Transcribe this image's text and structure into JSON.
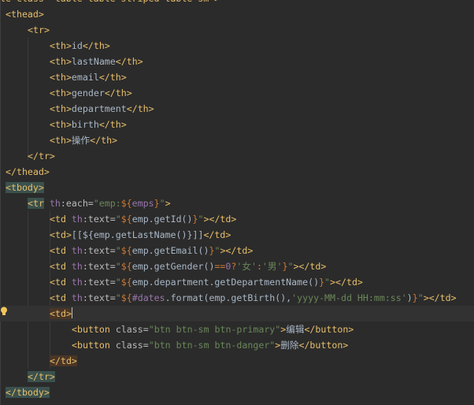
{
  "editor": {
    "language": "html",
    "current_line_index": 19
  },
  "lines": [
    {
      "indent": 0,
      "tokens": [
        {
          "t": "le class=\"table table-striped table-sm\">",
          "c": "tag"
        }
      ],
      "partial_top": true
    },
    {
      "indent": 0,
      "tokens": [
        {
          "t": "<thead>",
          "c": "tag"
        }
      ]
    },
    {
      "indent": 1,
      "tokens": [
        {
          "t": "<tr>",
          "c": "tag"
        }
      ]
    },
    {
      "indent": 2,
      "tokens": [
        {
          "t": "<th>",
          "c": "tag"
        },
        {
          "t": "id",
          "c": "txt"
        },
        {
          "t": "</th>",
          "c": "tag"
        }
      ]
    },
    {
      "indent": 2,
      "tokens": [
        {
          "t": "<th>",
          "c": "tag"
        },
        {
          "t": "lastName",
          "c": "txt"
        },
        {
          "t": "</th>",
          "c": "tag"
        }
      ]
    },
    {
      "indent": 2,
      "tokens": [
        {
          "t": "<th>",
          "c": "tag"
        },
        {
          "t": "email",
          "c": "txt"
        },
        {
          "t": "</th>",
          "c": "tag"
        }
      ]
    },
    {
      "indent": 2,
      "tokens": [
        {
          "t": "<th>",
          "c": "tag"
        },
        {
          "t": "gender",
          "c": "txt"
        },
        {
          "t": "</th>",
          "c": "tag"
        }
      ]
    },
    {
      "indent": 2,
      "tokens": [
        {
          "t": "<th>",
          "c": "tag"
        },
        {
          "t": "department",
          "c": "txt"
        },
        {
          "t": "</th>",
          "c": "tag"
        }
      ]
    },
    {
      "indent": 2,
      "tokens": [
        {
          "t": "<th>",
          "c": "tag"
        },
        {
          "t": "birth",
          "c": "txt"
        },
        {
          "t": "</th>",
          "c": "tag"
        }
      ]
    },
    {
      "indent": 2,
      "tokens": [
        {
          "t": "<th>",
          "c": "tag"
        },
        {
          "t": "操作",
          "c": "txt"
        },
        {
          "t": "</th>",
          "c": "tag"
        }
      ]
    },
    {
      "indent": 1,
      "tokens": [
        {
          "t": "</tr>",
          "c": "tag"
        }
      ]
    },
    {
      "indent": 0,
      "tokens": [
        {
          "t": "</thead>",
          "c": "tag"
        }
      ]
    },
    {
      "indent": 0,
      "tokens": [
        {
          "t": "<tbody>",
          "c": "tag hl-tag"
        }
      ]
    },
    {
      "indent": 1,
      "tokens": [
        {
          "t": "<tr",
          "c": "tag hl-tag"
        },
        {
          "t": " ",
          "c": "txt"
        },
        {
          "t": "th",
          "c": "ns"
        },
        {
          "t": ":each=",
          "c": "attr"
        },
        {
          "t": "\"",
          "c": "str"
        },
        {
          "t": "emp:",
          "c": "str"
        },
        {
          "t": "${",
          "c": "expr"
        },
        {
          "t": "emps",
          "c": "ns"
        },
        {
          "t": "}",
          "c": "expr"
        },
        {
          "t": "\"",
          "c": "str"
        },
        {
          "t": ">",
          "c": "tag"
        }
      ]
    },
    {
      "indent": 2,
      "tokens": [
        {
          "t": "<td ",
          "c": "tag"
        },
        {
          "t": "th",
          "c": "ns"
        },
        {
          "t": ":text=",
          "c": "attr"
        },
        {
          "t": "\"",
          "c": "str"
        },
        {
          "t": "${",
          "c": "expr"
        },
        {
          "t": "emp.getId()",
          "c": "txt"
        },
        {
          "t": "}",
          "c": "expr"
        },
        {
          "t": "\"",
          "c": "str"
        },
        {
          "t": "></td>",
          "c": "tag"
        }
      ]
    },
    {
      "indent": 2,
      "tokens": [
        {
          "t": "<td>",
          "c": "tag"
        },
        {
          "t": "[[${emp.getLastName()}]]",
          "c": "txt"
        },
        {
          "t": "</td>",
          "c": "tag"
        }
      ]
    },
    {
      "indent": 2,
      "tokens": [
        {
          "t": "<td ",
          "c": "tag"
        },
        {
          "t": "th",
          "c": "ns"
        },
        {
          "t": ":text=",
          "c": "attr"
        },
        {
          "t": "\"",
          "c": "str"
        },
        {
          "t": "${",
          "c": "expr"
        },
        {
          "t": "emp.getEmail()",
          "c": "txt"
        },
        {
          "t": "}",
          "c": "expr"
        },
        {
          "t": "\"",
          "c": "str"
        },
        {
          "t": "></td>",
          "c": "tag"
        }
      ]
    },
    {
      "indent": 2,
      "tokens": [
        {
          "t": "<td ",
          "c": "tag"
        },
        {
          "t": "th",
          "c": "ns"
        },
        {
          "t": ":text=",
          "c": "attr"
        },
        {
          "t": "\"",
          "c": "str"
        },
        {
          "t": "${",
          "c": "expr"
        },
        {
          "t": "emp.getGender()",
          "c": "txt"
        },
        {
          "t": "==",
          "c": "expr"
        },
        {
          "t": "0",
          "c": "ns"
        },
        {
          "t": "?",
          "c": "expr"
        },
        {
          "t": "'女'",
          "c": "str"
        },
        {
          "t": ":",
          "c": "expr"
        },
        {
          "t": "'男'",
          "c": "str"
        },
        {
          "t": "}",
          "c": "expr"
        },
        {
          "t": "\"",
          "c": "str"
        },
        {
          "t": "></td>",
          "c": "tag"
        }
      ]
    },
    {
      "indent": 2,
      "tokens": [
        {
          "t": "<td ",
          "c": "tag"
        },
        {
          "t": "th",
          "c": "ns"
        },
        {
          "t": ":text=",
          "c": "attr"
        },
        {
          "t": "\"",
          "c": "str"
        },
        {
          "t": "${",
          "c": "expr"
        },
        {
          "t": "emp.department.getDepartmentName()",
          "c": "txt"
        },
        {
          "t": "}",
          "c": "expr"
        },
        {
          "t": "\"",
          "c": "str"
        },
        {
          "t": "></td>",
          "c": "tag"
        }
      ]
    },
    {
      "indent": 2,
      "tokens": [
        {
          "t": "<td ",
          "c": "tag"
        },
        {
          "t": "th",
          "c": "ns"
        },
        {
          "t": ":text=",
          "c": "attr"
        },
        {
          "t": "\"",
          "c": "str"
        },
        {
          "t": "${",
          "c": "expr"
        },
        {
          "t": "#dates",
          "c": "ns"
        },
        {
          "t": ".format(emp.getBirth(),",
          "c": "txt"
        },
        {
          "t": "'yyyy-MM-dd HH:mm:ss'",
          "c": "str"
        },
        {
          "t": ")",
          "c": "txt"
        },
        {
          "t": "}",
          "c": "expr"
        },
        {
          "t": "\"",
          "c": "str"
        },
        {
          "t": "></td>",
          "c": "tag"
        }
      ]
    },
    {
      "indent": 2,
      "tokens": [
        {
          "t": "<td>",
          "c": "tag hl-td"
        },
        {
          "t": "",
          "c": "caret"
        }
      ],
      "current": true
    },
    {
      "indent": 3,
      "tokens": [
        {
          "t": "<button ",
          "c": "tag"
        },
        {
          "t": "class=",
          "c": "attr"
        },
        {
          "t": "\"btn btn-sm btn-primary\"",
          "c": "str"
        },
        {
          "t": ">",
          "c": "tag"
        },
        {
          "t": "编辑",
          "c": "txt"
        },
        {
          "t": "</button>",
          "c": "tag"
        }
      ]
    },
    {
      "indent": 3,
      "tokens": [
        {
          "t": "<button ",
          "c": "tag"
        },
        {
          "t": "class=",
          "c": "attr"
        },
        {
          "t": "\"btn btn-sm btn-danger\"",
          "c": "str"
        },
        {
          "t": ">",
          "c": "tag"
        },
        {
          "t": "删除",
          "c": "txt"
        },
        {
          "t": "</button>",
          "c": "tag"
        }
      ]
    },
    {
      "indent": 2,
      "tokens": [
        {
          "t": "</td>",
          "c": "tag hl-td"
        }
      ]
    },
    {
      "indent": 1,
      "tokens": [
        {
          "t": "</tr>",
          "c": "tag hl-tag"
        }
      ]
    },
    {
      "indent": 0,
      "tokens": [
        {
          "t": "</tbody>",
          "c": "tag hl-tag"
        }
      ]
    }
  ]
}
